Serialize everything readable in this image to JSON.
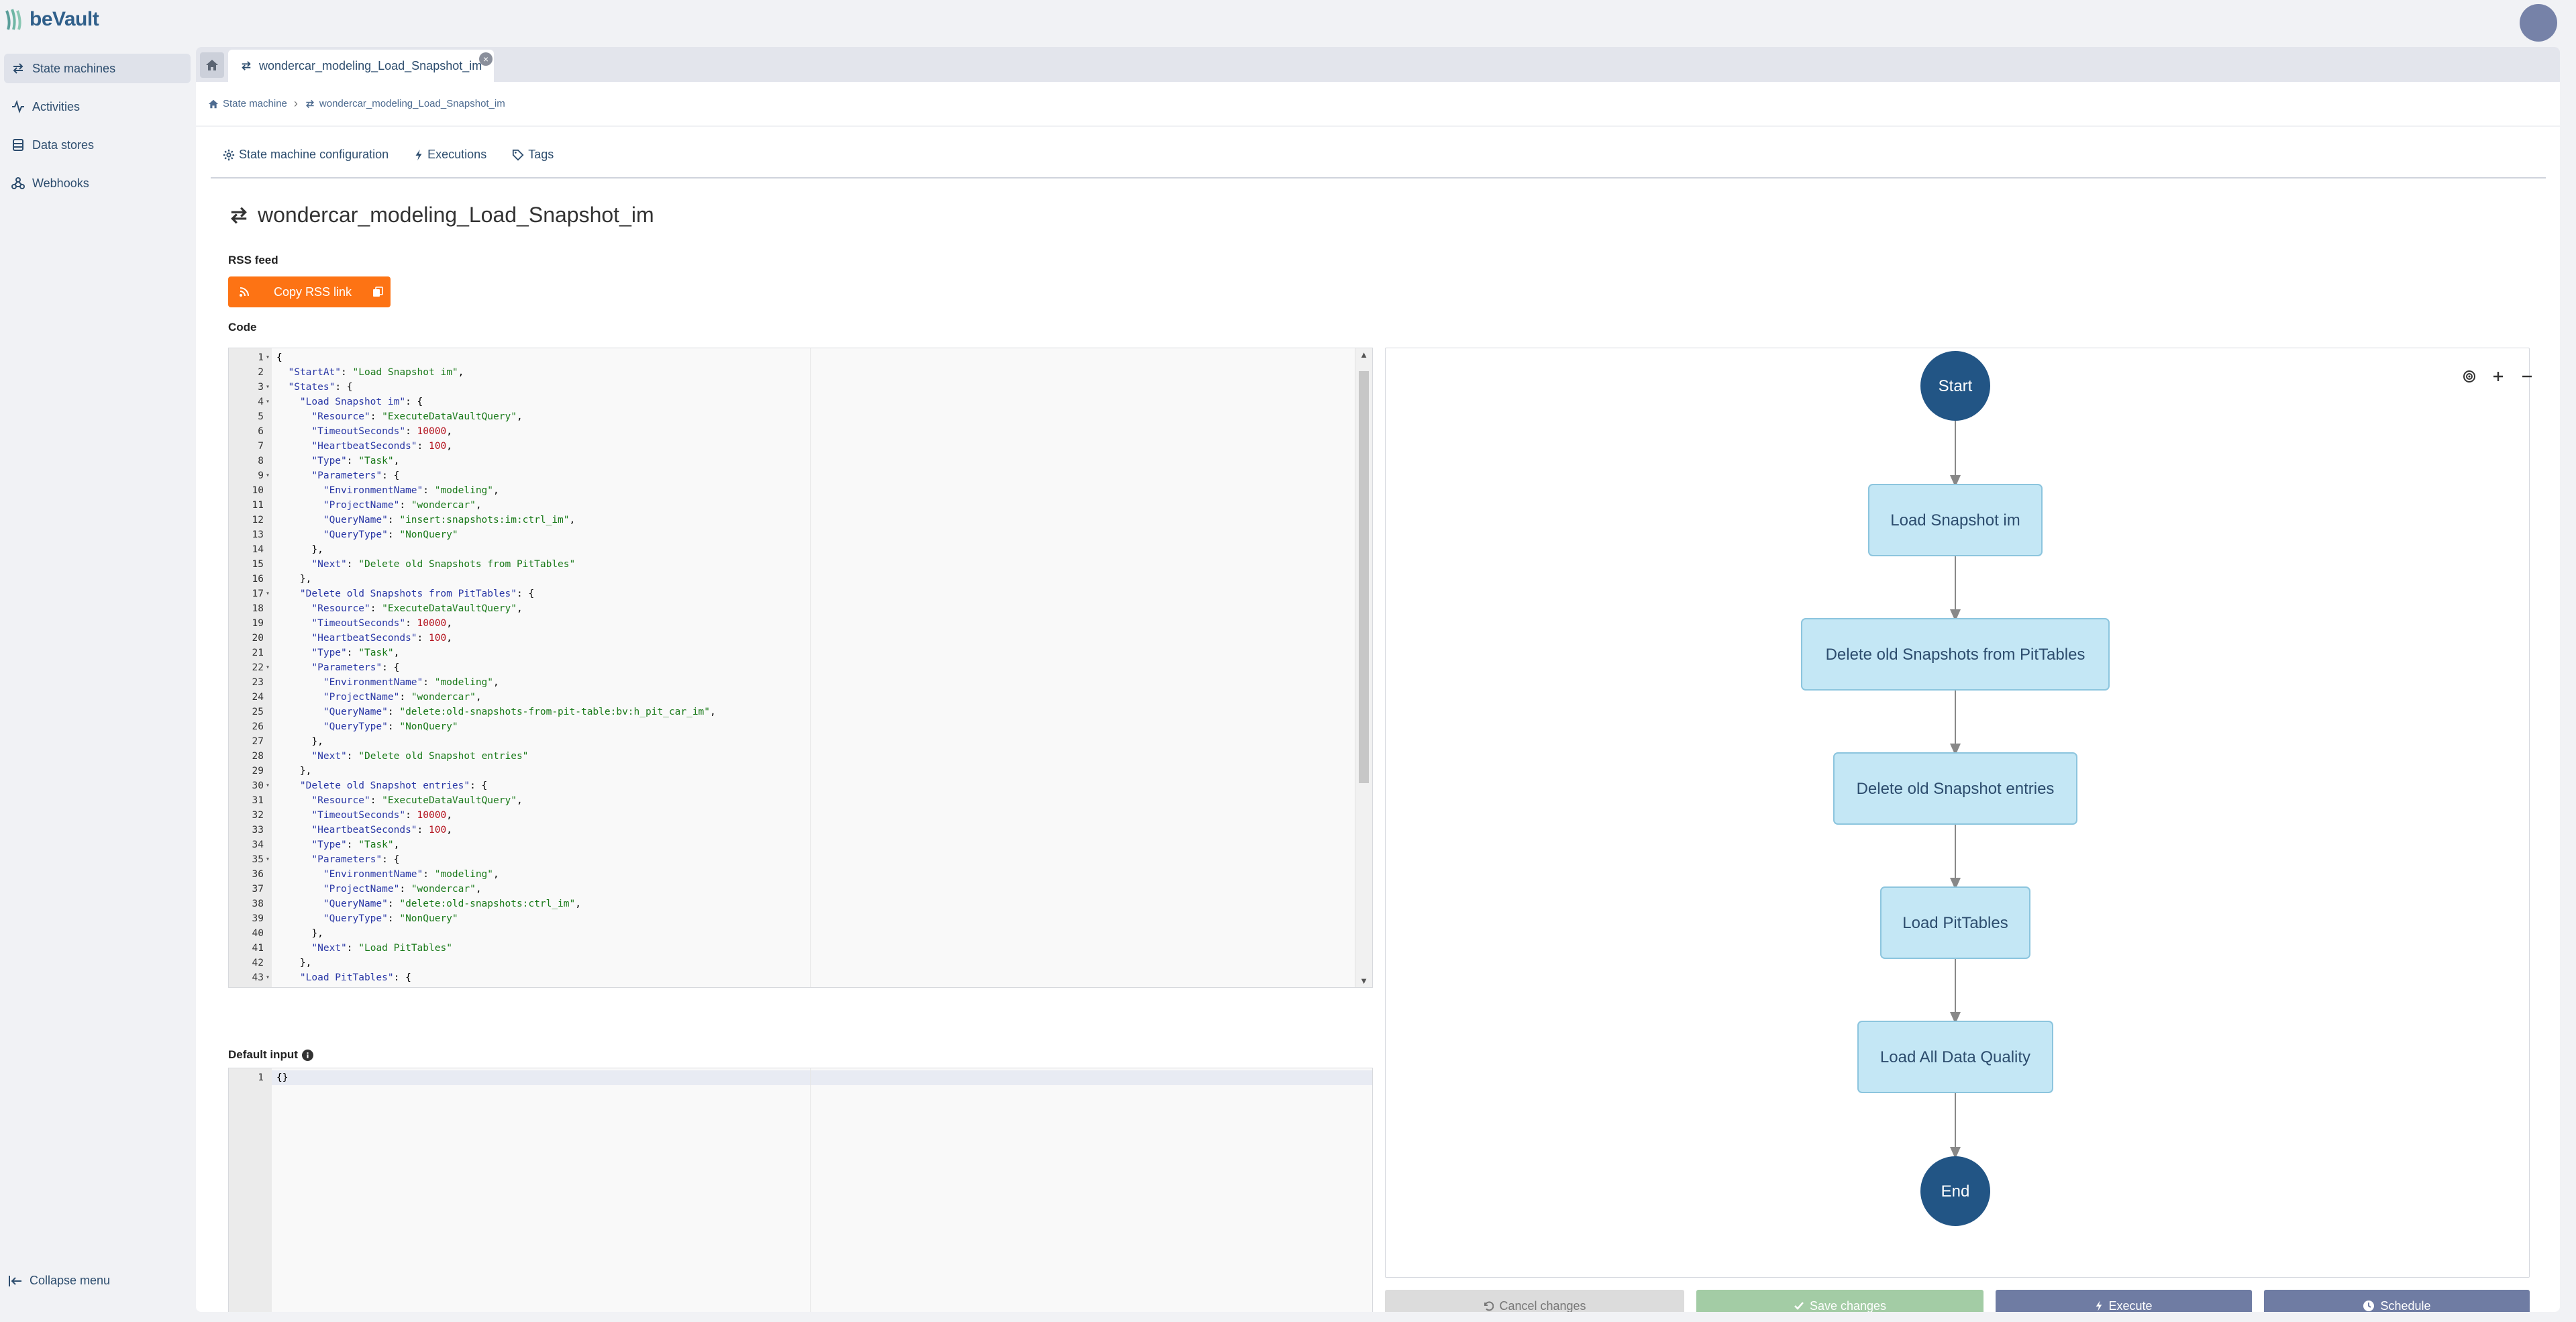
{
  "app": {
    "name": "beVault"
  },
  "sidebar": {
    "items": [
      {
        "label": "State machines",
        "icon": "exchange-icon"
      },
      {
        "label": "Activities",
        "icon": "activity-icon"
      },
      {
        "label": "Data stores",
        "icon": "database-icon"
      },
      {
        "label": "Webhooks",
        "icon": "webhook-icon"
      }
    ],
    "collapse_label": "Collapse menu"
  },
  "tabs": {
    "active_label": "wondercar_modeling_Load_Snapshot_im"
  },
  "breadcrumb": {
    "root": "State machine",
    "current": "wondercar_modeling_Load_Snapshot_im"
  },
  "page_tabs": [
    {
      "label": "State machine configuration",
      "icon": "gear-icon"
    },
    {
      "label": "Executions",
      "icon": "bolt-icon"
    },
    {
      "label": "Tags",
      "icon": "tag-icon"
    }
  ],
  "title": "wondercar_modeling_Load_Snapshot_im",
  "rss": {
    "label": "RSS feed",
    "button": "Copy RSS link"
  },
  "code": {
    "label": "Code",
    "lines": [
      "{",
      "  \"StartAt\": \"Load Snapshot im\",",
      "  \"States\": {",
      "    \"Load Snapshot im\": {",
      "      \"Resource\": \"ExecuteDataVaultQuery\",",
      "      \"TimeoutSeconds\": 10000,",
      "      \"HeartbeatSeconds\": 100,",
      "      \"Type\": \"Task\",",
      "      \"Parameters\": {",
      "        \"EnvironmentName\": \"modeling\",",
      "        \"ProjectName\": \"wondercar\",",
      "        \"QueryName\": \"insert:snapshots:im:ctrl_im\",",
      "        \"QueryType\": \"NonQuery\"",
      "      },",
      "      \"Next\": \"Delete old Snapshots from PitTables\"",
      "    },",
      "    \"Delete old Snapshots from PitTables\": {",
      "      \"Resource\": \"ExecuteDataVaultQuery\",",
      "      \"TimeoutSeconds\": 10000,",
      "      \"HeartbeatSeconds\": 100,",
      "      \"Type\": \"Task\",",
      "      \"Parameters\": {",
      "        \"EnvironmentName\": \"modeling\",",
      "        \"ProjectName\": \"wondercar\",",
      "        \"QueryName\": \"delete:old-snapshots-from-pit-table:bv:h_pit_car_im\",",
      "        \"QueryType\": \"NonQuery\"",
      "      },",
      "      \"Next\": \"Delete old Snapshot entries\"",
      "    },",
      "    \"Delete old Snapshot entries\": {",
      "      \"Resource\": \"ExecuteDataVaultQuery\",",
      "      \"TimeoutSeconds\": 10000,",
      "      \"HeartbeatSeconds\": 100,",
      "      \"Type\": \"Task\",",
      "      \"Parameters\": {",
      "        \"EnvironmentName\": \"modeling\",",
      "        \"ProjectName\": \"wondercar\",",
      "        \"QueryName\": \"delete:old-snapshots:ctrl_im\",",
      "        \"QueryType\": \"NonQuery\"",
      "      },",
      "      \"Next\": \"Load PitTables\"",
      "    },",
      "    \"Load PitTables\": {"
    ],
    "fold_lines": [
      1,
      3,
      4,
      9,
      17,
      22,
      30,
      35,
      43
    ]
  },
  "default_input": {
    "label": "Default input",
    "lines": [
      "{}"
    ]
  },
  "diagram": {
    "nodes": [
      {
        "label": "Start",
        "kind": "terminal"
      },
      {
        "label": "Load Snapshot im",
        "kind": "task"
      },
      {
        "label": "Delete old Snapshots from PitTables",
        "kind": "task"
      },
      {
        "label": "Delete old Snapshot entries",
        "kind": "task"
      },
      {
        "label": "Load PitTables",
        "kind": "task"
      },
      {
        "label": "Load All Data Quality",
        "kind": "task"
      },
      {
        "label": "End",
        "kind": "terminal"
      }
    ],
    "controls": [
      "target-icon",
      "plus-icon",
      "minus-icon"
    ]
  },
  "actions": {
    "cancel": "Cancel changes",
    "save": "Save changes",
    "execute": "Execute",
    "schedule": "Schedule"
  },
  "colors": {
    "accent_orange": "#fd7314",
    "primary_blue": "#2d4d6e",
    "node_fill": "#c4e7f5",
    "node_border": "#8cc5de",
    "terminal_fill": "#225585",
    "execute_button": "#6f7ca3",
    "save_button": "#a3cca5",
    "cancel_button": "#dcdcdc"
  }
}
